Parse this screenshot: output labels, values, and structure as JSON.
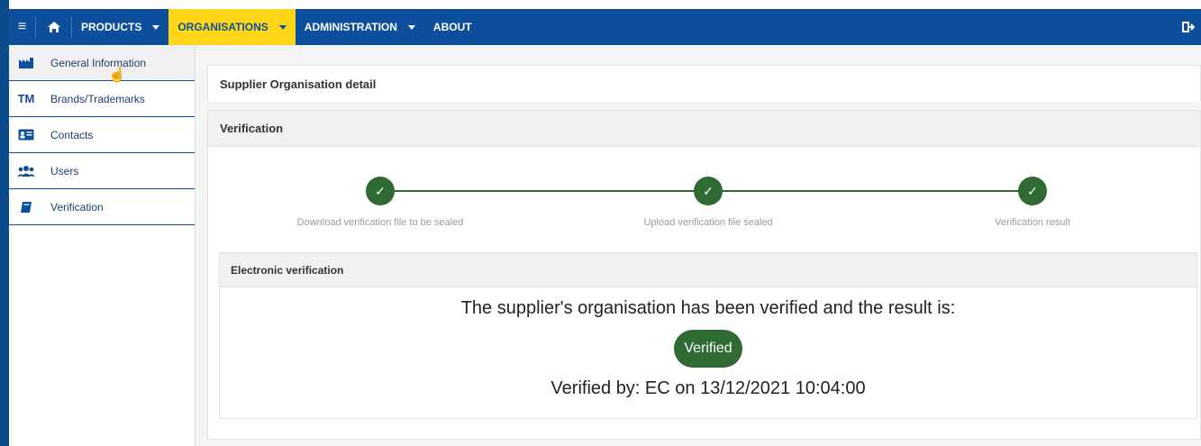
{
  "nav": {
    "products_label": "PRODUCTS",
    "organisations_label": "ORGANISATIONS",
    "administration_label": "ADMINISTRATION",
    "about_label": "ABOUT"
  },
  "sidebar": {
    "items": [
      {
        "label": "General Information",
        "icon": "factory-icon"
      },
      {
        "label": "Brands/Trademarks",
        "icon": "TM"
      },
      {
        "label": "Contacts",
        "icon": "contact-card-icon"
      },
      {
        "label": "Users",
        "icon": "users-icon"
      },
      {
        "label": "Verification",
        "icon": "book-icon"
      }
    ]
  },
  "main": {
    "detail_title": "Supplier Organisation detail",
    "verification_title": "Verification",
    "steps": [
      {
        "label": "Download verification file to be sealed"
      },
      {
        "label": "Upload verification file sealed"
      },
      {
        "label": "Verification result"
      }
    ],
    "electronic": {
      "title": "Electronic verification",
      "result_text": "The supplier's organisation has been verified and the result is:",
      "badge": "Verified",
      "verified_by": "Verified by: EC on 13/12/2021 10:04:00"
    }
  },
  "colors": {
    "nav_bg": "#0d4f9c",
    "nav_active": "#ffd617",
    "success": "#2f6a35"
  }
}
